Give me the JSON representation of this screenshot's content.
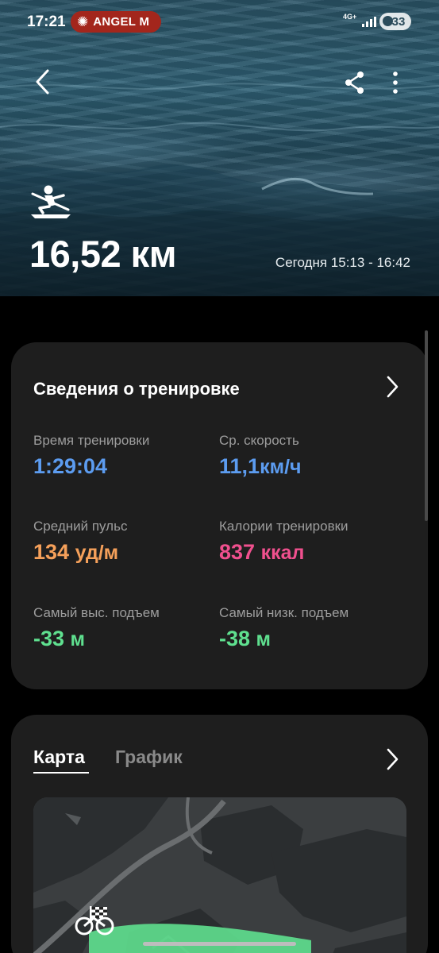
{
  "status_bar": {
    "time": "17:21",
    "notification": "ANGEL M",
    "network": "4G+",
    "battery": "33"
  },
  "header": {
    "distance": "16,52 км",
    "date_range": "Сегодня 15:13 - 16:42",
    "activity_icon": "rowing-icon"
  },
  "workout_details": {
    "title": "Сведения о тренировке",
    "stats": [
      {
        "label": "Время тренировки",
        "value": "1:29:04",
        "unit": ""
      },
      {
        "label": "Ср. скорость",
        "value": "11,1",
        "unit": "км/ч"
      },
      {
        "label": "Средний пульс",
        "value": "134",
        "unit": "уд/м"
      },
      {
        "label": "Калории тренировки",
        "value": "837",
        "unit": "ккал"
      },
      {
        "label": "Самый выс. подъем",
        "value": "-33",
        "unit": "м"
      },
      {
        "label": "Самый низк. подъем",
        "value": "-38",
        "unit": "м"
      }
    ]
  },
  "map_section": {
    "tabs": [
      {
        "label": "Карта",
        "active": true
      },
      {
        "label": "График",
        "active": false
      }
    ]
  },
  "colors": {
    "time": "#5c9cf0",
    "speed": "#5c9cf0",
    "heart_rate": "#f5a05a",
    "calories": "#f0508e",
    "elevation": "#5fe08f",
    "card_bg": "#1e1e1e"
  }
}
